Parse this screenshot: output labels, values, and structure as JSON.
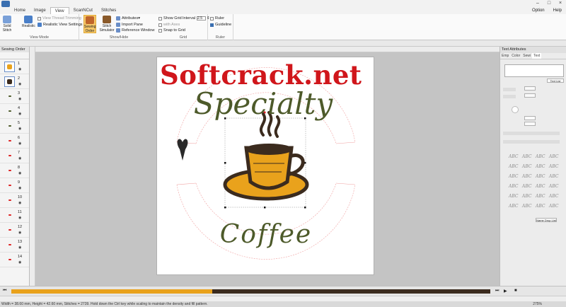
{
  "ribbon_tabs": [
    "Home",
    "Image",
    "View",
    "ScanNCut",
    "Stitches"
  ],
  "active_tab": "View",
  "top_right": [
    "Option",
    "Help"
  ],
  "view_mode": {
    "label": "View Mode",
    "buttons": [
      "Solid Stitch",
      "Realistic",
      "Sewing Order",
      "Stitch Simulator"
    ],
    "options": [
      "View Thread Trimming",
      "Realistic View Settings"
    ]
  },
  "show_hide": {
    "label": "Show/Hide",
    "options": [
      "Attributes",
      "Import Pane",
      "Reference Window"
    ]
  },
  "grid": {
    "label": "Grid",
    "options": [
      "Show Grid",
      "with Axes",
      "Snap to Grid"
    ],
    "interval_label": "Interval",
    "interval_value": "2.5"
  },
  "ruler": {
    "label": "Ruler",
    "options": [
      "Ruler",
      "Guideline"
    ]
  },
  "left_panel": {
    "title": "Sewing Order",
    "items": [
      "1",
      "2",
      "3",
      "4",
      "5",
      "6",
      "7",
      "8",
      "9",
      "10",
      "11",
      "12",
      "13",
      "14"
    ]
  },
  "right_panel": {
    "title": "Text Attributes",
    "tabs": [
      "Emp",
      "Color",
      "Sewi",
      "Text"
    ],
    "text_list_button": "Text List",
    "frame_button": "Name Drop List",
    "font_samples": [
      "ABC",
      "ABC",
      "ABC",
      "ABC",
      "ABC",
      "ABC",
      "ABC",
      "ABC",
      "ABC",
      "ABC",
      "ABC",
      "ABC",
      "ABC",
      "ABC",
      "ABC",
      "ABC",
      "ABC",
      "ABC",
      "ABC",
      "ABC",
      "ABC",
      "ABC",
      "ABC",
      "ABC"
    ]
  },
  "design": {
    "watermark": "Softcrack.net",
    "top_text": "Specialty",
    "bottom_text": "Coffee"
  },
  "timeline": {
    "progress": 0.42
  },
  "status_bar": "Width = 38.60 mm, Height = 42.60 mm, Stitches = 2739. Hold down the Ctrl key while scaling to maintain the density and fill pattern.",
  "zoom": "275%",
  "colors": {
    "thread_brown": "#3b2b1e",
    "thread_yellow": "#e9a21c",
    "thread_green": "#4d5a2a",
    "watermark_red": "#d0161b"
  }
}
